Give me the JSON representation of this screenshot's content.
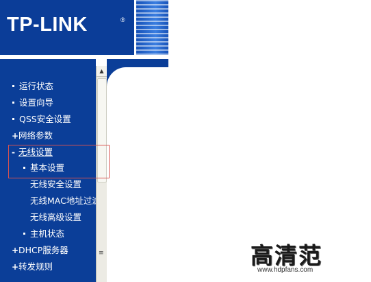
{
  "brand": {
    "logo": "TP-LINK",
    "reg_mark": "®"
  },
  "sidebar": {
    "items": [
      {
        "label": "运行状态",
        "marker": "bullet"
      },
      {
        "label": "设置向导",
        "marker": "bullet"
      },
      {
        "label": "QSS安全设置",
        "marker": "bullet"
      },
      {
        "label": "网络参数",
        "marker": "plus"
      },
      {
        "label": "无线设置",
        "marker": "minus",
        "expanded": true
      },
      {
        "label": "基本设置",
        "marker": "bullet",
        "sub": true,
        "selected": true
      },
      {
        "label": "无线安全设置",
        "marker": "none",
        "sub": true
      },
      {
        "label": "无线MAC地址过滤",
        "marker": "none",
        "sub": true
      },
      {
        "label": "无线高级设置",
        "marker": "none",
        "sub": true
      },
      {
        "label": "主机状态",
        "marker": "bullet",
        "sub": true
      },
      {
        "label": "DHCP服务器",
        "marker": "plus"
      },
      {
        "label": "转发规则",
        "marker": "plus"
      }
    ]
  },
  "watermark": {
    "text": "高清范",
    "url": "www.hdpfans.com"
  },
  "colors": {
    "navy": "#0b3e98",
    "highlight": "#d9534f"
  }
}
